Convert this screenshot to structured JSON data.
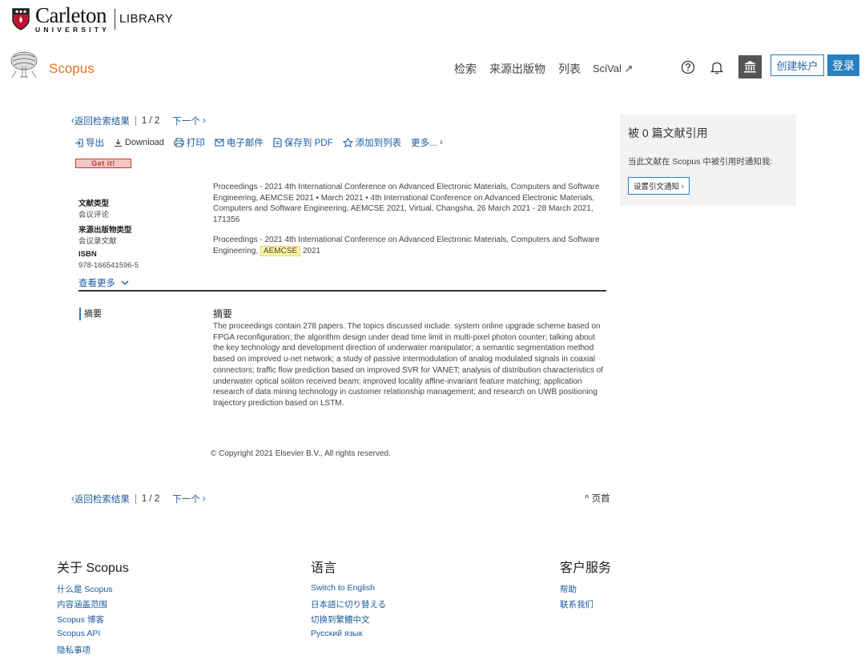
{
  "carleton": {
    "name": "Carleton",
    "university": "UNIVERSITY",
    "library": "LIBRARY"
  },
  "header": {
    "brand": "Scopus",
    "nav": [
      "检索",
      "来源出版物",
      "列表",
      "SciVal ↗"
    ],
    "create_account": "创建帐户",
    "login": "登录"
  },
  "pager": {
    "back": "返回检索结果",
    "count": "1 / 2",
    "next": "下一个"
  },
  "toolbar": {
    "export": "导出",
    "download": "Download",
    "print": "打印",
    "email": "电子邮件",
    "save_pdf": "保存到 PDF",
    "add_list": "添加到列表",
    "more": "更多..."
  },
  "getit": "Get it!",
  "meta": {
    "doc_type_label": "文献类型",
    "doc_type": "会议评论",
    "source_type_label": "来源出版物类型",
    "source_type": "会议录文献",
    "isbn_label": "ISBN",
    "isbn": "978-166541596-5",
    "see_more": "查看更多"
  },
  "proceedings": {
    "line1": "Proceedings - 2021 4th International Conference on Advanced Electronic Materials, Computers and Software Engineering, AEMCSE 2021 • March 2021 • 4th International Conference on Advanced Electronic Materials, Computers and Software Engineering, AEMCSE 2021, Virtual, Changsha, 26 March 2021 - 28 March 2021, 171356",
    "line2_pre": "Proceedings - 2021 4th International Conference on Advanced Electronic Materials, Computers and Software Engineering,",
    "line2_hl": "AEMCSE",
    "line2_post": "2021"
  },
  "abstract": {
    "tab": "摘要",
    "title": "摘要",
    "body": "The proceedings contain 278 papers. The topics discussed include: system online upgrade scheme based on FPGA reconfiguration; the algorithm design under dead time limit in multi-pixel photon counter; talking about the key technology and development direction of underwater manipulator; a semantic segmentation method based on improved u-net network; a study of passive intermodulation of analog modulated signals in coaxial connectors; traffic flow prediction based on improved SVR for VANET; analysis of distribution characteristics of underwater optical soliton received beam; improved locality affine-invariant feature matching; application research of data mining technology in customer relationship management; and research on UWB positioning trajectory prediction based on LSTM.",
    "copyright": "© Copyright 2021 Elsevier B.V., All rights reserved."
  },
  "top_link": "页首",
  "sidebar": {
    "title": "被 0 篇文献引用",
    "text": "当此文献在 Scopus 中被引用时通知我:",
    "button": "设置引文通知"
  },
  "footer": {
    "about": {
      "title": "关于 Scopus",
      "links": [
        "什么是 Scopus",
        "内容涵盖范围",
        "Scopus 博客",
        "Scopus API",
        "隐私事项"
      ]
    },
    "language": {
      "title": "语言",
      "links": [
        "Switch to English",
        "日本語に切り替える",
        "切换到繁體中文",
        "Русский язык"
      ]
    },
    "service": {
      "title": "客户服务",
      "links": [
        "帮助",
        "联系我们"
      ]
    }
  }
}
